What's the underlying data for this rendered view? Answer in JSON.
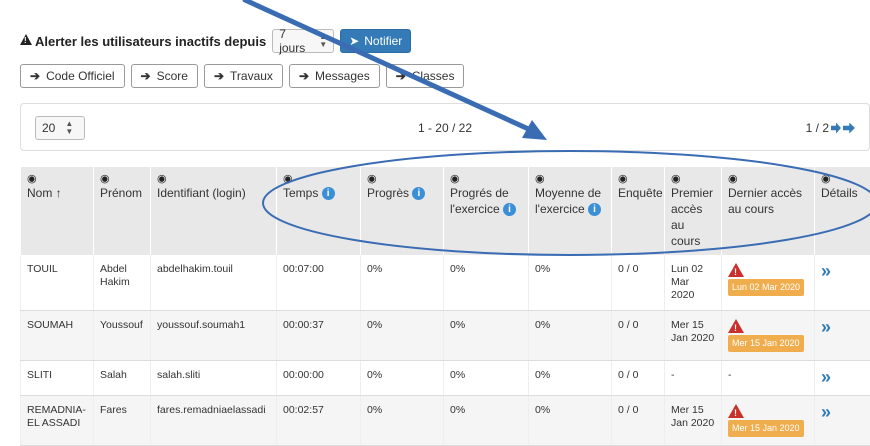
{
  "alert": {
    "label": "Alerter les utilisateurs inactifs depuis",
    "select_value": "7 jours",
    "notify_label": "Notifier"
  },
  "buttons": [
    "Code Officiel",
    "Score",
    "Travaux",
    "Messages",
    "Classes"
  ],
  "pager": {
    "per_page": "20",
    "range": "1 - 20 / 22",
    "page": "1 / 2"
  },
  "table": {
    "headers": {
      "nom": "Nom ↑",
      "prenom": "Prénom",
      "login": "Identifiant (login)",
      "temps": "Temps",
      "progres": "Progrès",
      "progres_ex": "Progrés de l'exercice",
      "moyenne": "Moyenne de l'exercice",
      "enquete": "Enquête",
      "premier": "Premier accès au cours",
      "dernier": "Dernier accès au cours",
      "details": "Détails"
    },
    "rows": [
      {
        "nom": "TOUIL",
        "prenom": "Abdel Hakim",
        "login": "abdelhakim.touil",
        "temps": "00:07:00",
        "progres": "0%",
        "progres_ex": "0%",
        "moyenne": "0%",
        "enquete": "0 / 0",
        "premier": "Lun 02 Mar 2020",
        "dernier": "Lun 02 Mar 2020"
      },
      {
        "nom": "SOUMAH",
        "prenom": "Youssouf",
        "login": "youssouf.soumah1",
        "temps": "00:00:37",
        "progres": "0%",
        "progres_ex": "0%",
        "moyenne": "0%",
        "enquete": "0 / 0",
        "premier": "Mer 15 Jan 2020",
        "dernier": "Mer 15 Jan 2020"
      },
      {
        "nom": "SLITI",
        "prenom": "Salah",
        "login": "salah.sliti",
        "temps": "00:00:00",
        "progres": "0%",
        "progres_ex": "0%",
        "moyenne": "0%",
        "enquete": "0 / 0",
        "premier": "-",
        "dernier": "-"
      },
      {
        "nom": "REMADNIA-EL ASSADI",
        "prenom": "Fares",
        "login": "fares.remadniaelassadi",
        "temps": "00:02:57",
        "progres": "0%",
        "progres_ex": "0%",
        "moyenne": "0%",
        "enquete": "0 / 0",
        "premier": "Mer 15 Jan 2020",
        "dernier": "Mer 15 Jan 2020"
      }
    ]
  },
  "colors": {
    "primary": "#337ab7",
    "badge": "#f0ad4e",
    "warning": "#c9302c",
    "annotation": "#3a6cb4"
  }
}
